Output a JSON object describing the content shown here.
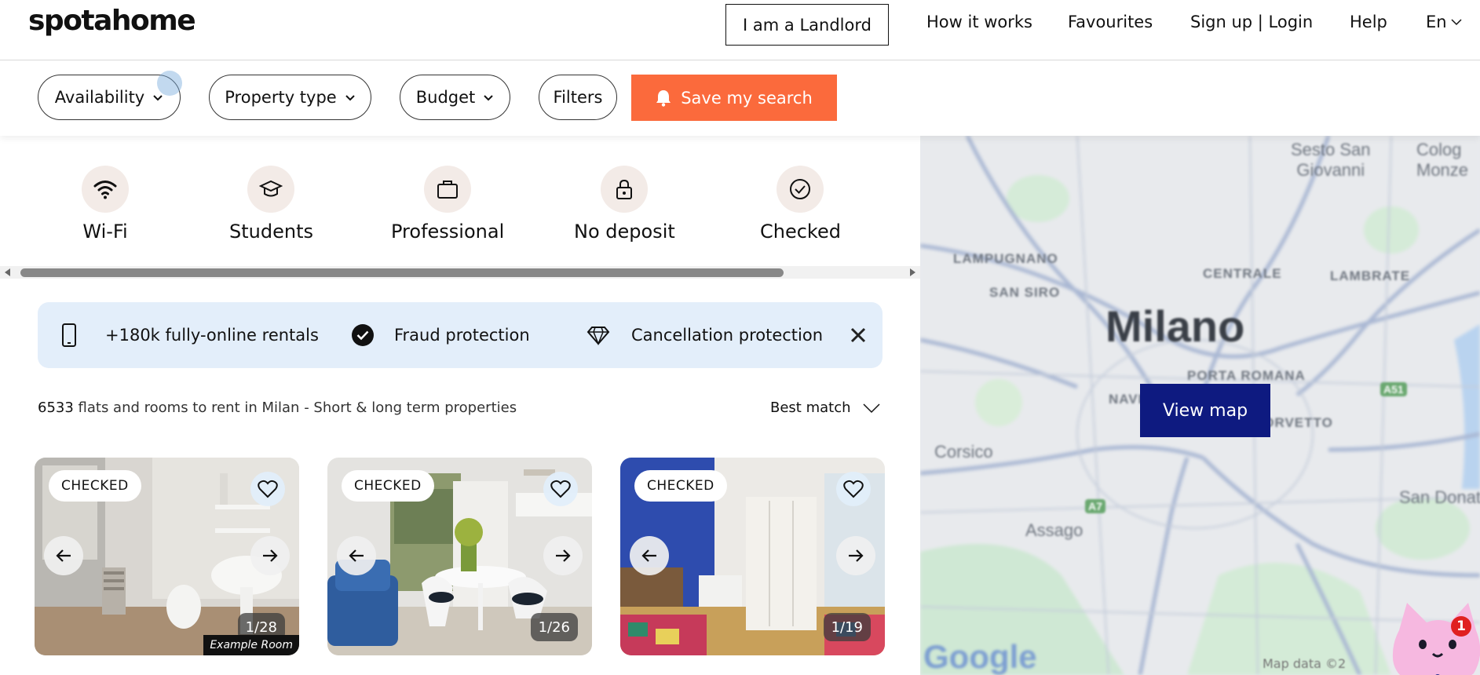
{
  "header": {
    "logo": "spotahome",
    "landlord_button": "I am a Landlord",
    "nav": [
      "How it works",
      "Favourites",
      "Sign up | Login",
      "Help"
    ],
    "language": "En"
  },
  "filters": {
    "availability": "Availability",
    "property_type": "Property type",
    "budget": "Budget",
    "filters": "Filters",
    "save_search": "Save my search"
  },
  "categories": [
    {
      "label": "Wi-Fi",
      "icon": "wifi-icon"
    },
    {
      "label": "Students",
      "icon": "graduation-cap-icon"
    },
    {
      "label": "Professional",
      "icon": "briefcase-icon"
    },
    {
      "label": "No deposit",
      "icon": "lock-icon"
    },
    {
      "label": "Checked",
      "icon": "check-circle-icon"
    }
  ],
  "banner": {
    "rentals": "+180k fully-online rentals",
    "fraud": "Fraud protection",
    "cancellation": "Cancellation protection"
  },
  "results": {
    "count": "6533",
    "text": " flats and rooms to rent in Milan - Short & long term properties",
    "sort": "Best match"
  },
  "cards": [
    {
      "badge": "CHECKED",
      "counter": "1/28",
      "tag": "Example Room"
    },
    {
      "badge": "CHECKED",
      "counter": "1/26"
    },
    {
      "badge": "CHECKED",
      "counter": "1/19"
    }
  ],
  "map": {
    "button": "View map",
    "labels": {
      "sesto": "Sesto San",
      "giovanni": "Giovanni",
      "cologno": "Colog",
      "monze": "Monze",
      "lampugnano": "LAMPUGNANO",
      "centrale": "CENTRALE",
      "lambrate": "LAMBRATE",
      "sansiro": "SAN SIRO",
      "milano": "Milano",
      "portaromana": "PORTA ROMANA",
      "navigli": "NAVIGLI",
      "corvetto": "CORVETTO",
      "corsico": "Corsico",
      "assago": "Assago",
      "sandonato": "San Donato",
      "a51": "A51",
      "a7": "A7",
      "mapdata": "Map data ©2"
    },
    "google": "Google",
    "chat_notifications": "1"
  },
  "colors": {
    "accent": "#fb6a3c",
    "map_button": "#0e1a80",
    "banner_bg": "#e3eefa",
    "category_bg": "#f3ebe7"
  }
}
